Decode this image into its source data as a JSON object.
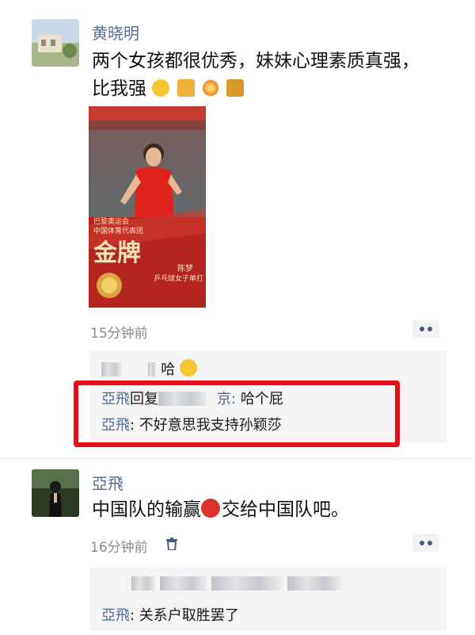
{
  "post1": {
    "author": "黄晓明",
    "text_line1": "两个女孩都很优秀，妹妹心理素质真强，",
    "text_line2": "比我强",
    "image": {
      "label_top": "巴黎奥运会",
      "label_team": "中国体育代表团",
      "medal": "金牌",
      "athlete": "陈梦",
      "event": "乒乓球女子单打"
    },
    "time": "15分钟前",
    "comments": [
      {
        "text": "哈"
      },
      {
        "name": "亞飛",
        "reply_word": "回复",
        "reply_tail": "京:",
        "text": "哈个屁"
      },
      {
        "name": "亞飛",
        "text": "不好意思我支持孙颖莎"
      }
    ]
  },
  "post2": {
    "author": "亞飛",
    "text_part1": "中国队的输赢",
    "text_part2": "交给中国队吧。",
    "time": "16分钟前",
    "comments": [
      {
        "name": "亞飛",
        "text": "关系户取胜罢了"
      }
    ]
  },
  "colors": {
    "name_blue": "#576b95",
    "highlight_red": "#e3101a",
    "comment_bg": "#f4f4f4"
  }
}
